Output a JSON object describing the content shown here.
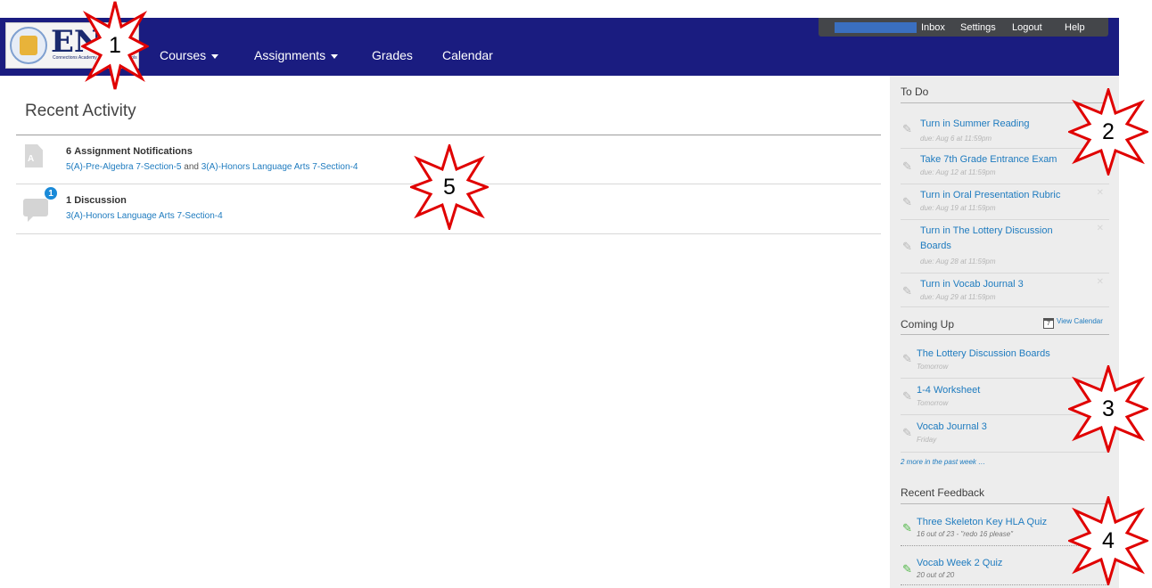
{
  "topbar": {
    "logo_text": "EN",
    "logo_tagline": "Connections Academy East Texas Schools",
    "nav": [
      {
        "label": "Courses",
        "has_caret": true
      },
      {
        "label": "Assignments",
        "has_caret": true
      },
      {
        "label": "Grades",
        "has_caret": false
      },
      {
        "label": "Calendar",
        "has_caret": false
      }
    ],
    "user_links": [
      "Inbox",
      "Settings",
      "Logout",
      "Help"
    ]
  },
  "main": {
    "heading": "Recent Activity",
    "activities": [
      {
        "count": "6",
        "title": "Assignment Notifications",
        "links": [
          "5(A)-Pre-Algebra 7-Section-5",
          "3(A)-Honors Language Arts 7-Section-4"
        ],
        "joiner": "and",
        "icon": "assignment-doc-icon"
      },
      {
        "count": "1",
        "title": "Discussion",
        "links": [
          "3(A)-Honors Language Arts 7-Section-4"
        ],
        "badge": "1",
        "icon": "discussion-bubble-icon"
      }
    ]
  },
  "sidebar": {
    "todo_title": "To Do",
    "todo": [
      {
        "label": "Turn in Summer Reading",
        "due": "due: Aug 6 at 11:59pm"
      },
      {
        "label": "Take 7th Grade Entrance Exam",
        "due": "due: Aug 12 at 11:59pm"
      },
      {
        "label": "Turn in Oral Presentation Rubric",
        "due": "due: Aug 19 at 11:59pm"
      },
      {
        "label": "Turn in The Lottery Discussion Boards",
        "due": "due: Aug 28 at 11:59pm"
      },
      {
        "label": "Turn in Vocab Journal 3",
        "due": "due: Aug 29 at 11:59pm"
      }
    ],
    "coming_title": "Coming Up",
    "view_calendar": "View Calendar",
    "calendar_day": "7",
    "coming": [
      {
        "label": "The Lottery Discussion Boards",
        "when": "Tomorrow"
      },
      {
        "label": "1-4 Worksheet",
        "when": "Tomorrow"
      },
      {
        "label": "Vocab Journal 3",
        "when": "Friday"
      }
    ],
    "more_link": "2 more in the past week …",
    "feedback_title": "Recent Feedback",
    "feedback": [
      {
        "label": "Three Skeleton Key HLA Quiz",
        "detail": "16 out of 23 - \"redo 16 please\""
      },
      {
        "label": "Vocab Week 2 Quiz",
        "detail": "20 out of 20"
      }
    ]
  },
  "callouts": [
    "1",
    "2",
    "3",
    "4",
    "5"
  ],
  "colors": {
    "nav_bg": "#1a1c80",
    "link": "#1e7bbf",
    "sidebar_bg": "#ededed",
    "callout_stroke": "#e00000"
  }
}
